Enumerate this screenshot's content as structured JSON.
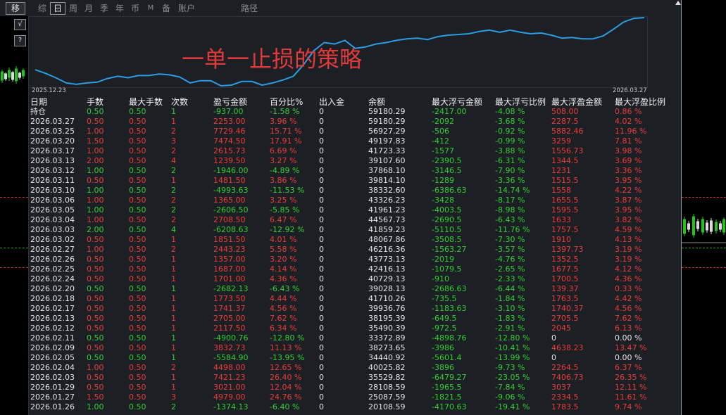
{
  "toolbar": {
    "move_label": "移",
    "tabs": [
      {
        "label": "综"
      },
      {
        "label": "日",
        "active": true
      },
      {
        "label": "周"
      },
      {
        "label": "月"
      },
      {
        "label": "季"
      },
      {
        "label": "年"
      },
      {
        "label": "币"
      },
      {
        "label": "M"
      },
      {
        "label": "备"
      },
      {
        "label": "账户"
      }
    ],
    "path_label": "路径"
  },
  "side_buttons": {
    "check_label": "√",
    "help_label": "?"
  },
  "overlay_title": "一单一止损的策略",
  "equity_curve": {
    "start_label": "2025.12.23",
    "end_label": "2026.03.27",
    "values": [
      29900,
      27840,
      25360,
      22470,
      21650,
      22470,
      22890,
      24950,
      26190,
      25360,
      26600,
      26600,
      27420,
      27010,
      25770,
      22470,
      23710,
      23710,
      20830,
      21240,
      23300,
      23300,
      21240,
      22470,
      24120,
      26190,
      32780,
      40620,
      45150,
      44330,
      46390,
      41860,
      42680,
      44330,
      45150,
      46390,
      47220,
      47630,
      46800,
      48450,
      49280,
      49690,
      50100,
      51340,
      52160,
      50930,
      52160,
      50930,
      50100,
      50520,
      49280,
      47630,
      48040,
      47220,
      47220,
      48870,
      52580,
      56700,
      58760,
      59180
    ]
  },
  "colors": {
    "text": "#e6e6e6",
    "up": "#ea3d3a",
    "down": "#33d033",
    "line": "#2a9de3"
  },
  "table": {
    "headers": [
      "日期",
      "手数",
      "最大手数",
      "次数",
      "盈亏金额",
      "百分比%",
      "出入金",
      "余额",
      "最大浮亏金额",
      "最大浮亏比例",
      "最大浮盈金额",
      "最大浮盈比例"
    ],
    "rows": [
      [
        "持仓",
        "0.50",
        "0.50",
        "1",
        "-937.00",
        "-1.58 %",
        "0",
        "59180.29",
        "-2417.00",
        "-4.08 %",
        "508.00",
        "0.86 %"
      ],
      [
        "2026.03.27",
        "0.50",
        "0.50",
        "1",
        "2253.00",
        "3.96 %",
        "0",
        "59180.29",
        "-2092",
        "-3.68 %",
        "2287.5",
        "4.02 %"
      ],
      [
        "2026.03.25",
        "1.00",
        "0.50",
        "2",
        "7729.46",
        "15.71 %",
        "0",
        "56927.29",
        "-506",
        "-0.92 %",
        "5882.46",
        "11.96 %"
      ],
      [
        "2026.03.20",
        "1.50",
        "0.50",
        "3",
        "7474.50",
        "17.91 %",
        "0",
        "49197.83",
        "-412",
        "-0.99 %",
        "3259",
        "7.81 %"
      ],
      [
        "2026.03.17",
        "1.00",
        "0.50",
        "2",
        "2615.73",
        "6.69 %",
        "0",
        "41723.33",
        "-1577",
        "-3.88 %",
        "1556.73",
        "3.98 %"
      ],
      [
        "2026.03.13",
        "2.00",
        "0.50",
        "4",
        "1239.50",
        "3.27 %",
        "0",
        "39107.60",
        "-2390.5",
        "-6.31 %",
        "1344.5",
        "3.69 %"
      ],
      [
        "2026.03.12",
        "1.00",
        "0.50",
        "2",
        "-1946.00",
        "-4.89 %",
        "0",
        "37868.10",
        "-3146.5",
        "-7.90 %",
        "1231",
        "3.36 %"
      ],
      [
        "2026.03.11",
        "0.50",
        "0.50",
        "1",
        "1481.50",
        "3.86 %",
        "0",
        "39814.10",
        "-1289",
        "-3.36 %",
        "1515.5",
        "3.95 %"
      ],
      [
        "2026.03.10",
        "1.00",
        "0.50",
        "2",
        "-4993.63",
        "-11.53 %",
        "0",
        "38332.60",
        "-6386.63",
        "-14.74 %",
        "1558",
        "4.22 %"
      ],
      [
        "2026.03.06",
        "1.00",
        "0.50",
        "2",
        "1365.00",
        "3.25 %",
        "0",
        "43326.23",
        "-3428",
        "-8.17 %",
        "1655.5",
        "3.87 %"
      ],
      [
        "2026.03.05",
        "1.00",
        "0.50",
        "2",
        "-2606.50",
        "-5.85 %",
        "0",
        "41961.23",
        "-4003.5",
        "-8.98 %",
        "1595.5",
        "3.95 %"
      ],
      [
        "2026.03.04",
        "1.00",
        "0.50",
        "2",
        "2708.50",
        "6.47 %",
        "0",
        "44567.73",
        "-2690.5",
        "-6.43 %",
        "1633",
        "3.82 %"
      ],
      [
        "2026.03.03",
        "2.00",
        "0.50",
        "4",
        "-6208.63",
        "-12.92 %",
        "0",
        "41859.23",
        "-5110.5",
        "-11.76 %",
        "1757.5",
        "4.59 %"
      ],
      [
        "2026.03.02",
        "0.50",
        "0.50",
        "1",
        "1851.50",
        "4.01 %",
        "0",
        "48067.86",
        "-3508.5",
        "-7.30 %",
        "1910",
        "4.13 %"
      ],
      [
        "2026.02.27",
        "1.00",
        "0.50",
        "2",
        "2443.23",
        "5.58 %",
        "0",
        "46216.36",
        "-1563.27",
        "-3.57 %",
        "1397.73",
        "3.19 %"
      ],
      [
        "2026.02.26",
        "0.50",
        "0.50",
        "1",
        "1357.00",
        "3.20 %",
        "0",
        "43773.13",
        "-2019",
        "-4.76 %",
        "1352.5",
        "3.19 %"
      ],
      [
        "2026.02.25",
        "0.50",
        "0.50",
        "1",
        "1687.00",
        "4.14 %",
        "0",
        "42416.13",
        "-1079.5",
        "-2.65 %",
        "1677.5",
        "4.12 %"
      ],
      [
        "2026.02.24",
        "0.50",
        "0.50",
        "1",
        "1701.00",
        "4.36 %",
        "0",
        "40729.13",
        "-910",
        "-2.33 %",
        "1700.5",
        "4.36 %"
      ],
      [
        "2026.02.20",
        "0.50",
        "0.50",
        "1",
        "-2682.13",
        "-6.43 %",
        "0",
        "39028.13",
        "-2686.63",
        "-6.44 %",
        "139.37",
        "0.33 %"
      ],
      [
        "2026.02.18",
        "0.50",
        "0.50",
        "1",
        "1773.50",
        "4.44 %",
        "0",
        "41710.26",
        "-735.5",
        "-1.84 %",
        "1763.5",
        "4.42 %"
      ],
      [
        "2026.02.17",
        "0.50",
        "0.50",
        "1",
        "1741.37",
        "4.56 %",
        "0",
        "39936.76",
        "-1183.63",
        "-3.10 %",
        "1740.37",
        "4.56 %"
      ],
      [
        "2026.02.13",
        "0.50",
        "0.50",
        "1",
        "2705.00",
        "7.62 %",
        "0",
        "38195.39",
        "-649.5",
        "-1.83 %",
        "2705.5",
        "7.62 %"
      ],
      [
        "2026.02.12",
        "0.50",
        "0.50",
        "1",
        "2117.50",
        "6.34 %",
        "0",
        "35490.39",
        "-972.5",
        "-2.91 %",
        "2045",
        "6.13 %"
      ],
      [
        "2026.02.11",
        "0.50",
        "0.50",
        "1",
        "-4900.76",
        "-12.80 %",
        "0",
        "33372.89",
        "-4898.76",
        "-12.80 %",
        "0",
        "0.00 %"
      ],
      [
        "2026.02.09",
        "0.50",
        "0.50",
        "1",
        "3832.73",
        "11.13 %",
        "0",
        "38273.65",
        "-3986",
        "-10.41 %",
        "4638.23",
        "13.47 %"
      ],
      [
        "2026.02.05",
        "0.50",
        "0.50",
        "1",
        "-5584.90",
        "-13.95 %",
        "0",
        "34440.92",
        "-5601.4",
        "-13.99 %",
        "0",
        "0.00 %"
      ],
      [
        "2026.02.04",
        "1.00",
        "0.50",
        "2",
        "4498.00",
        "12.65 %",
        "0",
        "40025.82",
        "-3896",
        "-9.73 %",
        "2264.5",
        "6.37 %"
      ],
      [
        "2026.02.03",
        "0.50",
        "0.50",
        "1",
        "7421.23",
        "26.40 %",
        "0",
        "35529.82",
        "-6479.27",
        "-23.05 %",
        "7406.73",
        "26.35 %"
      ],
      [
        "2026.01.29",
        "0.50",
        "0.50",
        "1",
        "3021.00",
        "12.04 %",
        "0",
        "28108.59",
        "-1965.5",
        "-7.84 %",
        "3037",
        "12.11 %"
      ],
      [
        "2026.01.27",
        "1.50",
        "0.50",
        "3",
        "4979.00",
        "24.76 %",
        "0",
        "25087.59",
        "-1821.5",
        "-9.06 %",
        "2334.5",
        "11.61 %"
      ],
      [
        "2026.01.26",
        "1.00",
        "0.50",
        "2",
        "-1374.13",
        "-6.40 %",
        "0",
        "20108.59",
        "-4170.63",
        "-19.41 %",
        "1783.5",
        "9.74 %"
      ]
    ]
  }
}
